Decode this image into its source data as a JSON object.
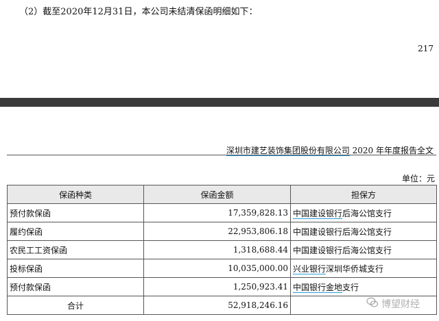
{
  "heading": "（2）截至2020年12月31日，本公司未结清保函明细如下：",
  "page_number": "217",
  "page_header": {
    "company": "深圳市建艺装饰集团股份有限公司",
    "report": " 2020 年年度报告全文"
  },
  "unit": "单位：元",
  "table": {
    "headers": [
      "保函种类",
      "保函金额",
      "担保方"
    ],
    "rows": [
      {
        "type": "预付款保函",
        "amount": "17,359,828.13",
        "bank": "中国建设银行",
        "branch": "后海公馆支行"
      },
      {
        "type": "履约保函",
        "amount": "22,953,806.18",
        "bank": "中国建设银行",
        "branch": "后海公馆支行"
      },
      {
        "type": "农民工工资保函",
        "amount": "1,318,688.44",
        "bank": "中国建设银行",
        "branch": "后海公馆支行"
      },
      {
        "type": "投标保函",
        "amount": "10,035,000.00",
        "bank": "兴业银行",
        "branch": "深圳华侨城支行"
      },
      {
        "type": "预付款保函",
        "amount": "1,250,923.41",
        "bank": "中国银行金地",
        "branch": "支行"
      }
    ],
    "total": {
      "label": "合计",
      "amount": "52,918,246.16",
      "guarantor": ""
    }
  },
  "watermark": {
    "icon": "wechat-bubble-icon",
    "text": "博望财经"
  }
}
